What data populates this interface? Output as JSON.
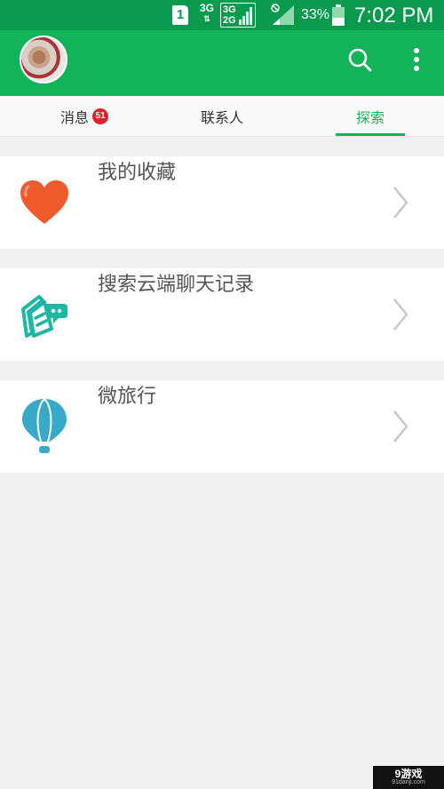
{
  "status_bar": {
    "sim_slot": "1",
    "network_1": "3G",
    "network_2_top": "3G",
    "network_2_bottom": "2G",
    "battery_percent": "33%",
    "time": "7:02 PM"
  },
  "app_bar": {
    "avatar_icon": "user-avatar",
    "search_icon": "search-icon",
    "more_icon": "more-vertical-icon"
  },
  "tabs": [
    {
      "label": "消息",
      "badge": "51"
    },
    {
      "label": "联系人"
    },
    {
      "label": "探索",
      "selected": true
    }
  ],
  "explore_items": [
    {
      "label": "我的收藏",
      "icon": "heart-icon"
    },
    {
      "label": "搜索云端聊天记录",
      "icon": "cloud-chat-search-icon"
    },
    {
      "label": "微旅行",
      "icon": "hot-air-balloon-icon"
    }
  ],
  "watermark": {
    "brand": "9游戏",
    "url": "91danji.com"
  },
  "colors": {
    "status_bar": "#0a9a4e",
    "app_bar": "#13b35a",
    "accent": "#13b35a",
    "badge": "#e0202a",
    "heart": "#f15a2a",
    "teal_icon": "#1fb7a3",
    "balloon": "#38a9c6"
  }
}
